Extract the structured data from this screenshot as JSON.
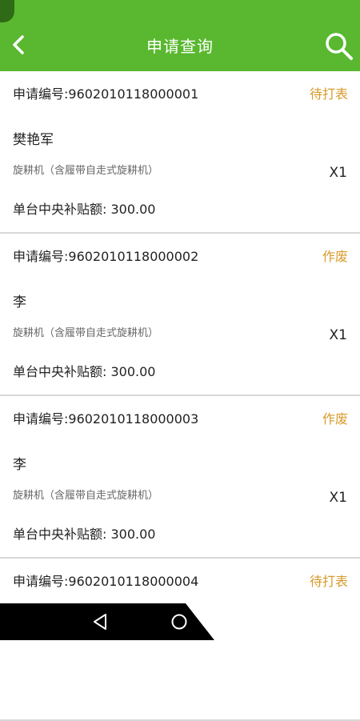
{
  "header": {
    "title": "申请查询"
  },
  "list": {
    "items": [
      {
        "application_no": "申请编号:9602010118000001",
        "status": "待打表",
        "applicant": "樊艳军",
        "product": "旋耕机（含履带自走式旋耕机）",
        "quantity": "X1",
        "subsidy": "单台中央补贴额: 300.00"
      },
      {
        "application_no": "申请编号:9602010118000002",
        "status": "作废",
        "applicant": "李",
        "product": "旋耕机（含履带自走式旋耕机）",
        "quantity": "X1",
        "subsidy": "单台中央补贴额: 300.00"
      },
      {
        "application_no": "申请编号:9602010118000003",
        "status": "作废",
        "applicant": "李",
        "product": "旋耕机（含履带自走式旋耕机）",
        "quantity": "X1",
        "subsidy": "单台中央补贴额: 300.00"
      },
      {
        "application_no": "申请编号:9602010118000004",
        "status": "待打表"
      }
    ]
  },
  "icons": {
    "back": "chevron-left-icon",
    "search": "search-icon",
    "nav_back": "triangle-back-icon",
    "nav_home": "circle-home-icon"
  },
  "colors": {
    "header_bg": "#59b82f",
    "status_text": "#d89a2a",
    "divider": "#d8d8d8"
  }
}
